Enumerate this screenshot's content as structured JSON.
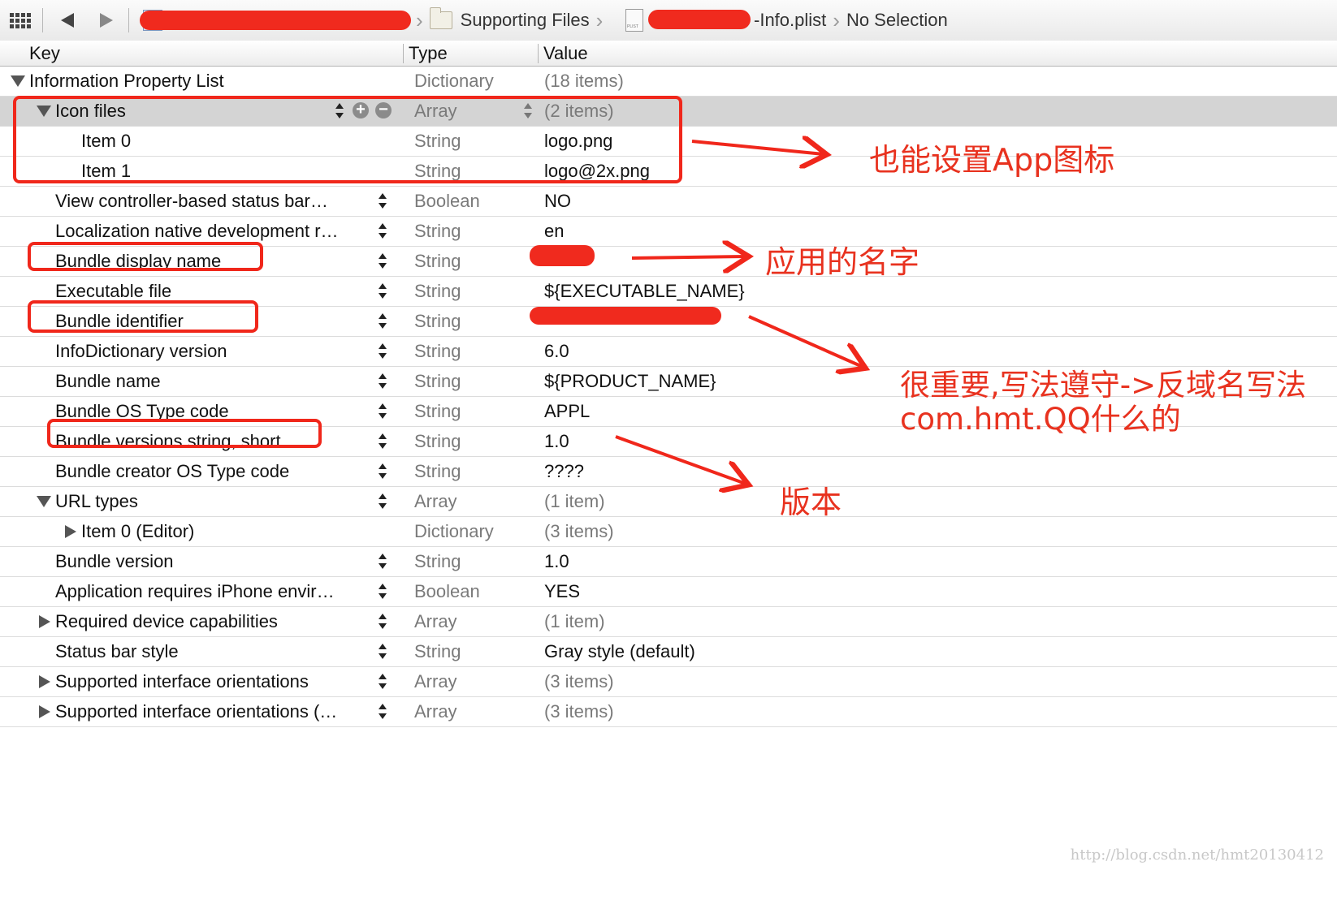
{
  "jumpbar": {
    "folder_label": "Supporting Files",
    "file_suffix": "-Info.plist",
    "selection_label": "No Selection"
  },
  "columns": {
    "key": "Key",
    "type": "Type",
    "value": "Value"
  },
  "rows": [
    {
      "key": "Information Property List",
      "type": "Dictionary",
      "value": "(18 items)"
    },
    {
      "key": "Icon files",
      "type": "Array",
      "value": "(2 items)"
    },
    {
      "key": "Item 0",
      "type": "String",
      "value": "logo.png"
    },
    {
      "key": "Item 1",
      "type": "String",
      "value": "logo@2x.png"
    },
    {
      "key": "View controller-based status bar…",
      "type": "Boolean",
      "value": "NO"
    },
    {
      "key": "Localization native development r…",
      "type": "String",
      "value": "en"
    },
    {
      "key": "Bundle display name",
      "type": "String",
      "value": ""
    },
    {
      "key": "Executable file",
      "type": "String",
      "value": "${EXECUTABLE_NAME}"
    },
    {
      "key": "Bundle identifier",
      "type": "String",
      "value": ""
    },
    {
      "key": "InfoDictionary version",
      "type": "String",
      "value": "6.0"
    },
    {
      "key": "Bundle name",
      "type": "String",
      "value": "${PRODUCT_NAME}"
    },
    {
      "key": "Bundle OS Type code",
      "type": "String",
      "value": "APPL"
    },
    {
      "key": "Bundle versions string, short",
      "type": "String",
      "value": "1.0"
    },
    {
      "key": "Bundle creator OS Type code",
      "type": "String",
      "value": "????"
    },
    {
      "key": "URL types",
      "type": "Array",
      "value": "(1 item)"
    },
    {
      "key": "Item 0 (Editor)",
      "type": "Dictionary",
      "value": "(3 items)"
    },
    {
      "key": "Bundle version",
      "type": "String",
      "value": "1.0"
    },
    {
      "key": "Application requires iPhone envir…",
      "type": "Boolean",
      "value": "YES"
    },
    {
      "key": "Required device capabilities",
      "type": "Array",
      "value": "(1 item)"
    },
    {
      "key": "Status bar style",
      "type": "String",
      "value": "Gray style (default)"
    },
    {
      "key": "Supported interface orientations",
      "type": "Array",
      "value": "(3 items)"
    },
    {
      "key": "Supported interface orientations (…",
      "type": "Array",
      "value": "(3 items)"
    }
  ],
  "annotations": {
    "icon_note": "也能设置App图标",
    "name_note": "应用的名字",
    "identifier_note_line1": "很重要,写法遵守->反域名写法",
    "identifier_note_line2": "com.hmt.QQ什么的",
    "version_note": "版本"
  },
  "watermark": "http://blog.csdn.net/hmt20130412",
  "colors": {
    "annotation_red": "#f0271b",
    "selected_row": "#d4d4d4"
  }
}
